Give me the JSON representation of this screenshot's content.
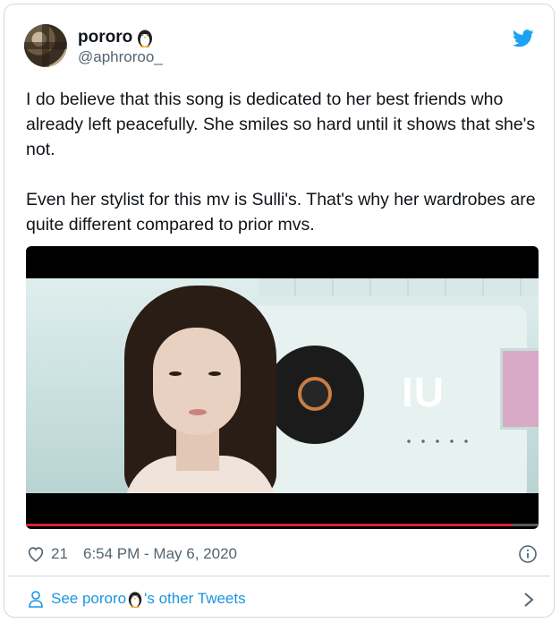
{
  "tweet": {
    "author": {
      "display_name": "pororo",
      "display_emoji": "penguin-emoji",
      "handle": "@aphroroo_"
    },
    "paragraphs": [
      "I do believe that this song is dedicated to her best friends who already left peacefully. She smiles so hard until it shows that she's not.",
      "Even her stylist for this mv is Sulli's. That's why her wardrobes are quite different compared to prior mvs."
    ],
    "media": {
      "overlay_text": "IU",
      "progress": 0.95
    },
    "likes": "21",
    "timestamp": "6:54 PM - May 6, 2020",
    "footer": {
      "prefix": "See pororo",
      "suffix": "'s other Tweets"
    }
  },
  "colors": {
    "brand": "#1da1f2",
    "link": "#1b95e0",
    "muted": "#536471",
    "progress": "#d9232d"
  },
  "icons": [
    "twitter-bird-icon",
    "heart-icon",
    "info-icon",
    "person-icon",
    "chevron-right-icon",
    "penguin-emoji"
  ]
}
